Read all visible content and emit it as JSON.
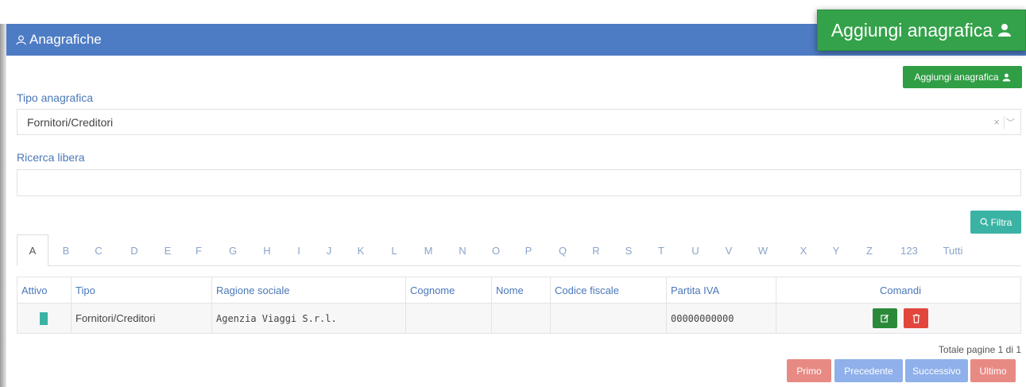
{
  "header": {
    "title": "Anagrafiche",
    "icon": "users-icon"
  },
  "actions": {
    "add_big_label": "Aggiungi anagrafica",
    "add_small_label": "Aggiungi anagrafica",
    "user_icon": "user-icon"
  },
  "form": {
    "type_label": "Tipo anagrafica",
    "type_value": "Fornitori/Creditori",
    "clear_glyph": "×",
    "chevron_glyph": "﹀",
    "search_label": "Ricerca libera",
    "search_value": "",
    "filter_label": "Filtra",
    "filter_icon": "search-icon"
  },
  "tabs": [
    "A",
    "B",
    "C",
    "D",
    "E",
    "F",
    "G",
    "H",
    "I",
    "J",
    "K",
    "L",
    "M",
    "N",
    "O",
    "P",
    "Q",
    "R",
    "S",
    "T",
    "U",
    "V",
    "W",
    "X",
    "Y",
    "Z",
    "123",
    "Tutti"
  ],
  "active_tab": "A",
  "table": {
    "headers": [
      "Attivo",
      "Tipo",
      "Ragione sociale",
      "Cognome",
      "Nome",
      "Codice fiscale",
      "Partita IVA",
      "Comandi"
    ],
    "rows": [
      {
        "tipo": "Fornitori/Creditori",
        "ragione_sociale": "Agenzia Viaggi S.r.l.",
        "cognome": "",
        "nome": "",
        "codice_fiscale": "",
        "partita_iva": "00000000000"
      }
    ]
  },
  "pagination": {
    "summary": "Totale pagine 1 di 1",
    "buttons": [
      "Primo",
      "Precedente",
      "Successivo",
      "Ultimo"
    ]
  },
  "colors": {
    "header_blue": "#4e7cc4",
    "add_green": "#34a24a",
    "filter_teal": "#3bb3a4",
    "delete_red": "#e2463c",
    "pager_red": "#e88a84",
    "pager_blue": "#8fb0ea"
  }
}
